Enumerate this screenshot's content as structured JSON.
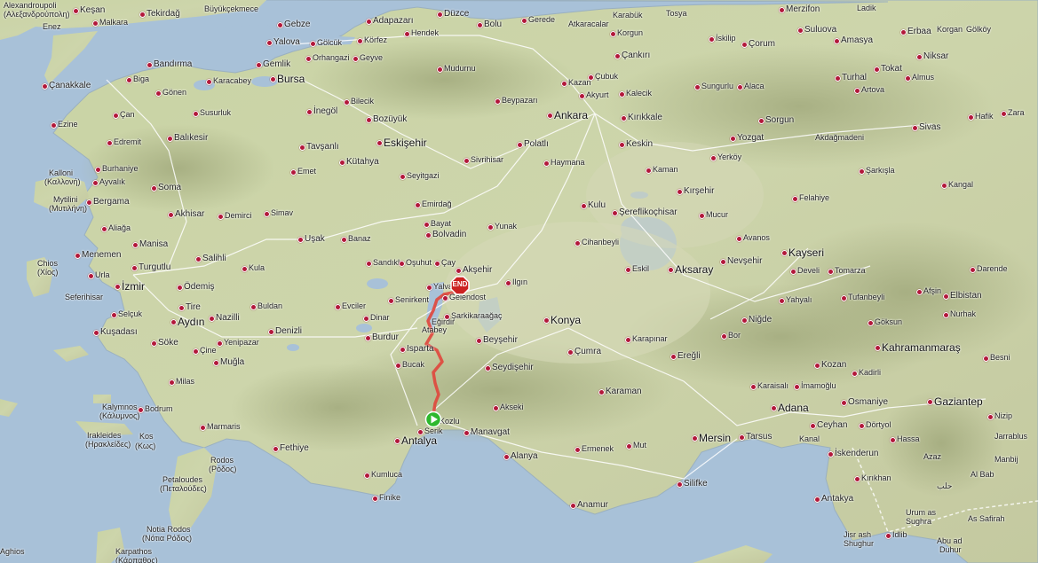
{
  "map": {
    "type": "terrain",
    "route": {
      "color": "#e0463c",
      "start": "Antalya",
      "end": "Akşehir"
    }
  },
  "markers": {
    "start_icon": "play-icon",
    "end_icon": "stop-octagon-icon",
    "end_label": "END",
    "start_color": "#2eb82e",
    "end_color": "#cc2222"
  },
  "labels": [
    {
      "id": "alexandroupoli",
      "text": "Alexandroupoli",
      "size": "small"
    },
    {
      "id": "alexandroupoli-gr",
      "text": "(Αλεξανδρούπολη)",
      "size": "small"
    },
    {
      "id": "kesan",
      "text": "Keşan",
      "size": "mid"
    },
    {
      "id": "malkara",
      "text": "Malkara",
      "size": "small"
    },
    {
      "id": "tekirdag",
      "text": "Tekirdağ",
      "size": "mid"
    },
    {
      "id": "buyukcekmece",
      "text": "Büyükçekmece",
      "size": "small"
    },
    {
      "id": "enez",
      "text": "Enez",
      "size": "small"
    },
    {
      "id": "gebze",
      "text": "Gebze",
      "size": "mid"
    },
    {
      "id": "adapazari",
      "text": "Adapazarı",
      "size": "mid"
    },
    {
      "id": "duzce",
      "text": "Düzce",
      "size": "mid"
    },
    {
      "id": "bolu",
      "text": "Bolu",
      "size": "mid"
    },
    {
      "id": "gerede",
      "text": "Gerede",
      "size": "small"
    },
    {
      "id": "atkaracalar",
      "text": "Atkaracalar",
      "size": "small"
    },
    {
      "id": "karabuk",
      "text": "Karabük",
      "size": "small"
    },
    {
      "id": "tosya",
      "text": "Tosya",
      "size": "small"
    },
    {
      "id": "merzifon",
      "text": "Merzifon",
      "size": "mid"
    },
    {
      "id": "ladik",
      "text": "Ladik",
      "size": "small"
    },
    {
      "id": "yalova",
      "text": "Yalova",
      "size": "mid"
    },
    {
      "id": "golcuk",
      "text": "Gölcük",
      "size": "small"
    },
    {
      "id": "korfez",
      "text": "Körfez",
      "size": "small"
    },
    {
      "id": "hendek",
      "text": "Hendek",
      "size": "small"
    },
    {
      "id": "korgun",
      "text": "Korgun",
      "size": "small"
    },
    {
      "id": "iskilip",
      "text": "İskilip",
      "size": "small"
    },
    {
      "id": "corum",
      "text": "Çorum",
      "size": "mid"
    },
    {
      "id": "suluova",
      "text": "Suluova",
      "size": "mid"
    },
    {
      "id": "amasya",
      "text": "Amasya",
      "size": "mid"
    },
    {
      "id": "erbaa",
      "text": "Erbaa",
      "size": "mid"
    },
    {
      "id": "korgan",
      "text": "Korgan",
      "size": "small"
    },
    {
      "id": "golkoy",
      "text": "Gölköy",
      "size": "small"
    },
    {
      "id": "orhangazi",
      "text": "Orhangazi",
      "size": "small"
    },
    {
      "id": "geyve",
      "text": "Geyve",
      "size": "small"
    },
    {
      "id": "cankiri",
      "text": "Çankırı",
      "size": "mid"
    },
    {
      "id": "niksar",
      "text": "Niksar",
      "size": "mid"
    },
    {
      "id": "bandirma",
      "text": "Bandırma",
      "size": "mid"
    },
    {
      "id": "gemlik",
      "text": "Gemlik",
      "size": "mid"
    },
    {
      "id": "mudurnu",
      "text": "Mudurnu",
      "size": "small"
    },
    {
      "id": "cubuk",
      "text": "Çubuk",
      "size": "small"
    },
    {
      "id": "tokat",
      "text": "Tokat",
      "size": "mid"
    },
    {
      "id": "canakkale",
      "text": "Çanakkale",
      "size": "mid"
    },
    {
      "id": "biga",
      "text": "Biga",
      "size": "small"
    },
    {
      "id": "karacabey",
      "text": "Karacabey",
      "size": "small"
    },
    {
      "id": "bursa",
      "text": "Bursa",
      "size": "big"
    },
    {
      "id": "kazan",
      "text": "Kazan",
      "size": "small"
    },
    {
      "id": "akyurt",
      "text": "Akyurt",
      "size": "small"
    },
    {
      "id": "kalecik",
      "text": "Kalecik",
      "size": "small"
    },
    {
      "id": "sungurlu",
      "text": "Sungurlu",
      "size": "small"
    },
    {
      "id": "alaca",
      "text": "Alaca",
      "size": "small"
    },
    {
      "id": "turhal",
      "text": "Turhal",
      "size": "mid"
    },
    {
      "id": "almus",
      "text": "Almus",
      "size": "small"
    },
    {
      "id": "gonen",
      "text": "Gönen",
      "size": "small"
    },
    {
      "id": "bilecik",
      "text": "Bilecik",
      "size": "small"
    },
    {
      "id": "beypazari",
      "text": "Beypazarı",
      "size": "small"
    },
    {
      "id": "artova",
      "text": "Artova",
      "size": "small"
    },
    {
      "id": "ezine",
      "text": "Ezine",
      "size": "small"
    },
    {
      "id": "can",
      "text": "Çan",
      "size": "small"
    },
    {
      "id": "susurluk",
      "text": "Susurluk",
      "size": "small"
    },
    {
      "id": "inegol",
      "text": "İnegöl",
      "size": "mid"
    },
    {
      "id": "bozuyuk",
      "text": "Bozüyük",
      "size": "mid"
    },
    {
      "id": "ankara",
      "text": "Ankara",
      "size": "big"
    },
    {
      "id": "kirikkale",
      "text": "Kırıkkale",
      "size": "mid"
    },
    {
      "id": "sorgun",
      "text": "Sorgun",
      "size": "mid"
    },
    {
      "id": "hafik",
      "text": "Hafik",
      "size": "small"
    },
    {
      "id": "zara",
      "text": "Zara",
      "size": "small"
    },
    {
      "id": "edremit",
      "text": "Edremit",
      "size": "small"
    },
    {
      "id": "balikesir",
      "text": "Balıkesir",
      "size": "mid"
    },
    {
      "id": "tavsanli",
      "text": "Tavşanlı",
      "size": "mid"
    },
    {
      "id": "eskisehir",
      "text": "Eskişehir",
      "size": "big"
    },
    {
      "id": "polatli",
      "text": "Polatlı",
      "size": "mid"
    },
    {
      "id": "keskin",
      "text": "Keskin",
      "size": "mid"
    },
    {
      "id": "yozgat",
      "text": "Yozgat",
      "size": "mid"
    },
    {
      "id": "akdagmadeni",
      "text": "Akdağmadeni",
      "size": "small"
    },
    {
      "id": "sivas",
      "text": "Sivas",
      "size": "mid"
    },
    {
      "id": "burhaniye",
      "text": "Burhaniye",
      "size": "small"
    },
    {
      "id": "kutahya",
      "text": "Kütahya",
      "size": "mid"
    },
    {
      "id": "sivrihisar",
      "text": "Sivrihisar",
      "size": "small"
    },
    {
      "id": "haymana",
      "text": "Haymana",
      "size": "small"
    },
    {
      "id": "kaman",
      "text": "Kaman",
      "size": "small"
    },
    {
      "id": "yerkoy",
      "text": "Yerköy",
      "size": "small"
    },
    {
      "id": "kalloni",
      "text": "Kalloni",
      "size": "small"
    },
    {
      "id": "kalloni-gr",
      "text": "(Καλλονή)",
      "size": "small"
    },
    {
      "id": "ayvalik",
      "text": "Ayvalık",
      "size": "small"
    },
    {
      "id": "emet",
      "text": "Emet",
      "size": "small"
    },
    {
      "id": "seyitgazi",
      "text": "Seyitgazi",
      "size": "small"
    },
    {
      "id": "sarkisla",
      "text": "Şarkışla",
      "size": "small"
    },
    {
      "id": "mytilini",
      "text": "Mytilini",
      "size": "small"
    },
    {
      "id": "mytilini-gr",
      "text": "(Μυτιλήνη)",
      "size": "small"
    },
    {
      "id": "soma",
      "text": "Soma",
      "size": "mid"
    },
    {
      "id": "kirsehir",
      "text": "Kırşehir",
      "size": "mid"
    },
    {
      "id": "felahiye",
      "text": "Felahiye",
      "size": "small"
    },
    {
      "id": "kangal",
      "text": "Kangal",
      "size": "small"
    },
    {
      "id": "bergama",
      "text": "Bergama",
      "size": "mid"
    },
    {
      "id": "akhisar",
      "text": "Akhisar",
      "size": "mid"
    },
    {
      "id": "demirci",
      "text": "Demirci",
      "size": "small"
    },
    {
      "id": "simav",
      "text": "Simav",
      "size": "small"
    },
    {
      "id": "emirdag",
      "text": "Emirdağ",
      "size": "small"
    },
    {
      "id": "kulu",
      "text": "Kulu",
      "size": "mid"
    },
    {
      "id": "sereflikochisar",
      "text": "Şereflikoçhisar",
      "size": "mid"
    },
    {
      "id": "mucur",
      "text": "Mucur",
      "size": "small"
    },
    {
      "id": "bayat",
      "text": "Bayat",
      "size": "small"
    },
    {
      "id": "yunak",
      "text": "Yunak",
      "size": "small"
    },
    {
      "id": "aliaga",
      "text": "Aliağa",
      "size": "small"
    },
    {
      "id": "bolvadin",
      "text": "Bolvadin",
      "size": "mid"
    },
    {
      "id": "cihanbeyli",
      "text": "Cihanbeyli",
      "size": "small"
    },
    {
      "id": "avanos",
      "text": "Avanos",
      "size": "small"
    },
    {
      "id": "manisa",
      "text": "Manisa",
      "size": "mid"
    },
    {
      "id": "usak",
      "text": "Uşak",
      "size": "mid"
    },
    {
      "id": "banaz",
      "text": "Banaz",
      "size": "small"
    },
    {
      "id": "kayseri",
      "text": "Kayseri",
      "size": "big"
    },
    {
      "id": "menemen",
      "text": "Menemen",
      "size": "mid"
    },
    {
      "id": "salihli",
      "text": "Salihli",
      "size": "mid"
    },
    {
      "id": "sandikli",
      "text": "Sandıklı",
      "size": "small"
    },
    {
      "id": "osuhut",
      "text": "Oşuhut",
      "size": "small"
    },
    {
      "id": "cay",
      "text": "Çay",
      "size": "small"
    },
    {
      "id": "nevsehir",
      "text": "Nevşehir",
      "size": "mid"
    },
    {
      "id": "chios",
      "text": "Chios",
      "size": "small"
    },
    {
      "id": "chios-gr",
      "text": "(Χίος)",
      "size": "small"
    },
    {
      "id": "urla",
      "text": "Urla",
      "size": "small"
    },
    {
      "id": "turgutlu",
      "text": "Turgutlu",
      "size": "mid"
    },
    {
      "id": "kula",
      "text": "Kula",
      "size": "small"
    },
    {
      "id": "aksehir",
      "text": "Akşehir",
      "size": "mid"
    },
    {
      "id": "eskil",
      "text": "Eskil",
      "size": "small"
    },
    {
      "id": "aksaray",
      "text": "Aksaray",
      "size": "big"
    },
    {
      "id": "develi",
      "text": "Develi",
      "size": "small"
    },
    {
      "id": "tomarza",
      "text": "Tomarza",
      "size": "small"
    },
    {
      "id": "darende",
      "text": "Darende",
      "size": "small"
    },
    {
      "id": "izmir",
      "text": "İzmir",
      "size": "big"
    },
    {
      "id": "odemis",
      "text": "Ödemiş",
      "size": "mid"
    },
    {
      "id": "senirkent",
      "text": "Senirkent",
      "size": "small"
    },
    {
      "id": "yalvac",
      "text": "Yalvaç",
      "size": "small"
    },
    {
      "id": "ilgin",
      "text": "Ilgın",
      "size": "small"
    },
    {
      "id": "afsin",
      "text": "Afşin",
      "size": "small"
    },
    {
      "id": "seferihisar",
      "text": "Seferihisar",
      "size": "small"
    },
    {
      "id": "gelendost",
      "text": "Gelendost",
      "size": "small"
    },
    {
      "id": "yahyali",
      "text": "Yahyalı",
      "size": "small"
    },
    {
      "id": "elbistan",
      "text": "Elbistan",
      "size": "mid"
    },
    {
      "id": "tufanbeyli",
      "text": "Tufanbeyli",
      "size": "small"
    },
    {
      "id": "evciler",
      "text": "Evciler",
      "size": "small"
    },
    {
      "id": "buldan",
      "text": "Buldan",
      "size": "small"
    },
    {
      "id": "sarkikaraagac",
      "text": "Şarkikaraağaç",
      "size": "small"
    },
    {
      "id": "tire",
      "text": "Tire",
      "size": "mid"
    },
    {
      "id": "dinar",
      "text": "Dinar",
      "size": "small"
    },
    {
      "id": "nurhak",
      "text": "Nurhak",
      "size": "small"
    },
    {
      "id": "selcuk",
      "text": "Selçuk",
      "size": "small"
    },
    {
      "id": "nazilli",
      "text": "Nazilli",
      "size": "mid"
    },
    {
      "id": "egirdir",
      "text": "Eğirdir",
      "size": "small"
    },
    {
      "id": "konya",
      "text": "Konya",
      "size": "big"
    },
    {
      "id": "nigde",
      "text": "Niğde",
      "size": "mid"
    },
    {
      "id": "goksun",
      "text": "Göksun",
      "size": "small"
    },
    {
      "id": "aydin",
      "text": "Aydın",
      "size": "big"
    },
    {
      "id": "bor",
      "text": "Bor",
      "size": "small"
    },
    {
      "id": "kusadasi",
      "text": "Kuşadası",
      "size": "mid"
    },
    {
      "id": "denizli",
      "text": "Denizli",
      "size": "mid"
    },
    {
      "id": "burdur",
      "text": "Burdur",
      "size": "mid"
    },
    {
      "id": "beysehir",
      "text": "Beyşehir",
      "size": "mid"
    },
    {
      "id": "karapinar",
      "text": "Karapınar",
      "size": "small"
    },
    {
      "id": "kahramanmaras",
      "text": "Kahramanmaraş",
      "size": "big"
    },
    {
      "id": "soke",
      "text": "Söke",
      "size": "mid"
    },
    {
      "id": "yenipazar",
      "text": "Yenipazar",
      "size": "small"
    },
    {
      "id": "isparta",
      "text": "Isparta",
      "size": "mid"
    },
    {
      "id": "cumra",
      "text": "Çumra",
      "size": "mid"
    },
    {
      "id": "eregli",
      "text": "Ereğli",
      "size": "mid"
    },
    {
      "id": "besni",
      "text": "Besni",
      "size": "small"
    },
    {
      "id": "cine",
      "text": "Çine",
      "size": "small"
    },
    {
      "id": "bucak",
      "text": "Bucak",
      "size": "small"
    },
    {
      "id": "seydisehir",
      "text": "Seydişehir",
      "size": "mid"
    },
    {
      "id": "kozan",
      "text": "Kozan",
      "size": "mid"
    },
    {
      "id": "kadirli",
      "text": "Kadirli",
      "size": "small"
    },
    {
      "id": "milas",
      "text": "Milas",
      "size": "small"
    },
    {
      "id": "karaisali",
      "text": "Karaisalı",
      "size": "small"
    },
    {
      "id": "imamoglu",
      "text": "İmamoğlu",
      "size": "small"
    },
    {
      "id": "mugla",
      "text": "Muğla",
      "size": "mid"
    },
    {
      "id": "karaman",
      "text": "Karaman",
      "size": "mid"
    },
    {
      "id": "gaziantep",
      "text": "Gaziantep",
      "size": "big"
    },
    {
      "id": "adana",
      "text": "Adana",
      "size": "big"
    },
    {
      "id": "osmaniye",
      "text": "Osmaniye",
      "size": "mid"
    },
    {
      "id": "kalymnos",
      "text": "Kalymnos",
      "size": "small"
    },
    {
      "id": "kalymnos-gr",
      "text": "(Κάλυμνος)",
      "size": "small"
    },
    {
      "id": "bodrum",
      "text": "Bodrum",
      "size": "small"
    },
    {
      "id": "akseki",
      "text": "Akseki",
      "size": "small"
    },
    {
      "id": "nizip",
      "text": "Nizip",
      "size": "small"
    },
    {
      "id": "ceyhan",
      "text": "Ceyhan",
      "size": "mid"
    },
    {
      "id": "dortyol",
      "text": "Dörtyol",
      "size": "small"
    },
    {
      "id": "marmaris",
      "text": "Marmaris",
      "size": "small"
    },
    {
      "id": "manavgat",
      "text": "Manavgat",
      "size": "mid"
    },
    {
      "id": "antalya",
      "text": "Antalya",
      "size": "big"
    },
    {
      "id": "mersin",
      "text": "Mersin",
      "size": "big"
    },
    {
      "id": "tarsus",
      "text": "Tarsus",
      "size": "mid"
    },
    {
      "id": "hassa",
      "text": "Hassa",
      "size": "small"
    },
    {
      "id": "jarrablus",
      "text": "Jarrablus",
      "size": "small"
    },
    {
      "id": "irakleides",
      "text": "Irakleides",
      "size": "small"
    },
    {
      "id": "irakleides-gr",
      "text": "(Ηρακλείδες)",
      "size": "small"
    },
    {
      "id": "kos",
      "text": "Kos",
      "size": "small"
    },
    {
      "id": "kos-gr",
      "text": "(Κως)",
      "size": "small"
    },
    {
      "id": "fethiye",
      "text": "Fethiye",
      "size": "mid"
    },
    {
      "id": "ermenek",
      "text": "Ermenek",
      "size": "small"
    },
    {
      "id": "mut",
      "text": "Mut",
      "size": "small"
    },
    {
      "id": "iskenderun",
      "text": "İskenderun",
      "size": "mid"
    },
    {
      "id": "alanya",
      "text": "Alanya",
      "size": "mid"
    },
    {
      "id": "azaz",
      "text": "Azaz",
      "size": "small"
    },
    {
      "id": "rodos",
      "text": "Rodos",
      "size": "small"
    },
    {
      "id": "rodos-gr",
      "text": "(Ρόδος)",
      "size": "small"
    },
    {
      "id": "manbij",
      "text": "Manbij",
      "size": "small"
    },
    {
      "id": "kumluca",
      "text": "Kumluca",
      "size": "small"
    },
    {
      "id": "kirikhan",
      "text": "Kırıkhan",
      "size": "small"
    },
    {
      "id": "al-bab",
      "text": "Al Bab",
      "size": "small"
    },
    {
      "id": "silifke",
      "text": "Silifke",
      "size": "mid"
    },
    {
      "id": "petaloudes",
      "text": "Petaloudes",
      "size": "small"
    },
    {
      "id": "petaloudes-gr",
      "text": "(Πεταλούδες)",
      "size": "small"
    },
    {
      "id": "halab-ar",
      "text": "حلب",
      "size": "small"
    },
    {
      "id": "antakya",
      "text": "Antakya",
      "size": "mid"
    },
    {
      "id": "finike",
      "text": "Finike",
      "size": "small"
    },
    {
      "id": "anamur",
      "text": "Anamur",
      "size": "mid"
    },
    {
      "id": "urum-as",
      "text": "Urum as",
      "size": "small"
    },
    {
      "id": "sughra",
      "text": "Sughra",
      "size": "small"
    },
    {
      "id": "as-safirah",
      "text": "As Safirah",
      "size": "small"
    },
    {
      "id": "notia-rodos",
      "text": "Notia Rodos",
      "size": "small"
    },
    {
      "id": "notia-rodos-gr",
      "text": "(Νότια Ρόδος)",
      "size": "small"
    },
    {
      "id": "jisrash",
      "text": "Jisr ash",
      "size": "small"
    },
    {
      "id": "shughur",
      "text": "Shughur",
      "size": "small"
    },
    {
      "id": "idlib",
      "text": "Idlib",
      "size": "small"
    },
    {
      "id": "abu-ad",
      "text": "Abu ad",
      "size": "small"
    },
    {
      "id": "duhur",
      "text": "Duhur",
      "size": "small"
    },
    {
      "id": "aghios",
      "text": "Aghios",
      "size": "small"
    },
    {
      "id": "karpathos",
      "text": "Karpathos",
      "size": "small"
    },
    {
      "id": "karpathos-gr",
      "text": "(Κάρπαθος)",
      "size": "small"
    },
    {
      "id": "serik",
      "text": "Serik",
      "size": "small"
    },
    {
      "id": "kozlu",
      "text": "Kozlu",
      "size": "small"
    },
    {
      "id": "atabey",
      "text": "Atabey",
      "size": "small"
    },
    {
      "id": "ceyhan-river",
      "text": "Kanal",
      "size": "small"
    }
  ]
}
